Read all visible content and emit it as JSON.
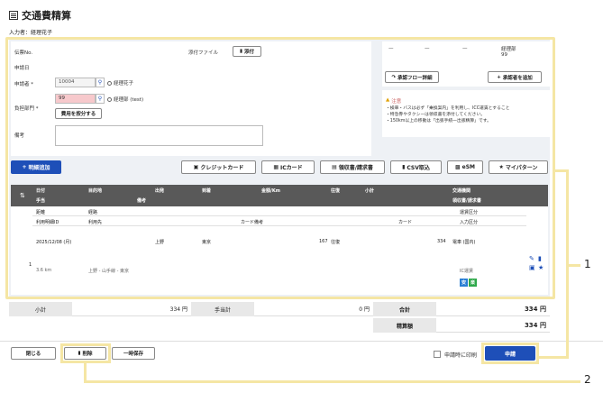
{
  "header": {
    "title": "交通費精算",
    "inputter": "入力者：経理花子"
  },
  "form": {
    "slip_no_label": "伝票No.",
    "apply_date_label": "申請日",
    "applicant_label": "申請者 *",
    "applicant_code": "10004",
    "applicant_name": "経理花子",
    "dept_label": "負担部門 *",
    "dept_code": "99",
    "dept_name": "経理部 (test)",
    "split_button": "費用を按分する",
    "remarks_label": "備考",
    "attach_label": "添付ファイル",
    "attach_button": "添付"
  },
  "approval": {
    "cells": [
      "—",
      "—",
      "—"
    ],
    "approver_dept": "経理部",
    "approver_code": "99",
    "flow_button": "承認フロー詳細",
    "add_approver_button": "承認者を追加"
  },
  "note": {
    "title": "注意",
    "lines": [
      "・検車・バスは必ず「乗換案内」を利用し、ICC運賃とすること",
      "・特急券やタクシーは領収書を添付してください。",
      "・150km以上の移動は「出張手続一出張精算」です。"
    ]
  },
  "toolbar": {
    "add_detail": "明細追加",
    "credit_card": "クレジットカード",
    "ic_card": "ICカード",
    "receipt": "領収書/請求書",
    "csv_import": "CSV取込",
    "esm": "eSM",
    "my_pattern": "マイパターン"
  },
  "grid": {
    "header_row1": [
      "日付",
      "目的地",
      "出発",
      "到着",
      "金額/Km",
      "往復",
      "小計",
      "交通機関"
    ],
    "header_row2_left": "手当",
    "header_row2_mid": "備考",
    "header_row2_right": "領収書/請求書",
    "subheader_row1": [
      "距離",
      "経路",
      "運賃区分"
    ],
    "subheader_row2": [
      "利用明細ID",
      "利用先",
      "カード備考",
      "カード",
      "入力区分"
    ],
    "row": {
      "index": "1",
      "date": "2025/12/08 (月)",
      "from": "上野",
      "to": "東京",
      "amount": "167",
      "round_trip": "往復",
      "subtotal": "334",
      "transport": "電車 (国内)",
      "distance": "3.6 km",
      "route": "上野 - 山手線 - 東京",
      "fare_type": "IC運賃",
      "badge_safe": "安",
      "badge_eco": "楽"
    }
  },
  "summary": {
    "subtotal_label": "小計",
    "subtotal_value": "334 円",
    "allowance_label": "手当計",
    "allowance_value": "0 円",
    "total_label": "合計",
    "total_value": "334 円",
    "settle_label": "精算額",
    "settle_value": "334 円"
  },
  "footer": {
    "close_button": "閉じる",
    "delete_button": "削除",
    "save_draft_button": "一時保存",
    "print_label": "申請時に印刷",
    "submit_button": "申請"
  },
  "callouts": {
    "one": "1",
    "two": "2"
  },
  "colors": {
    "accent": "#1e4fb8",
    "highlight": "#f5e6a4",
    "header_dark": "#595959",
    "error_bg": "#f7c9cc"
  }
}
